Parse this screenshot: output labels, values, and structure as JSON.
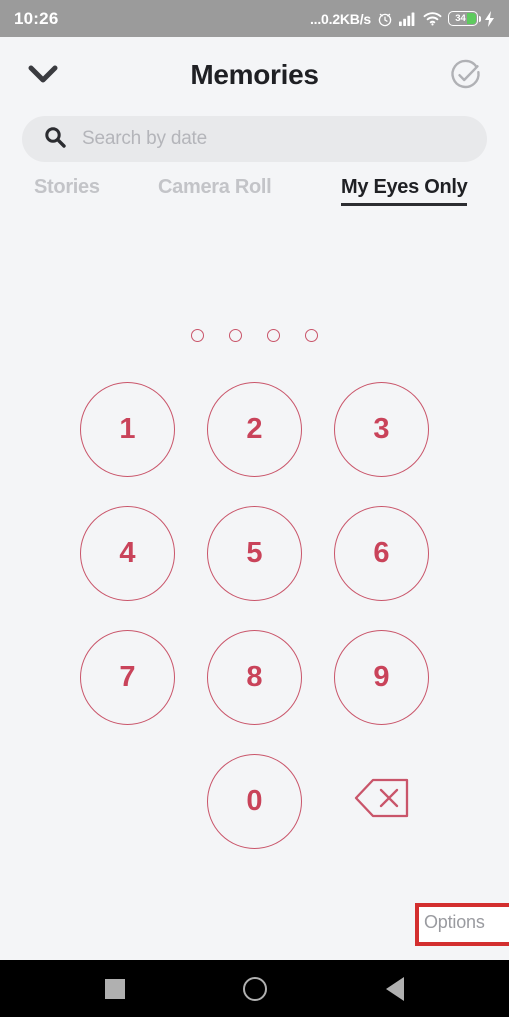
{
  "status_bar": {
    "time": "10:26",
    "network_speed": "...0.2KB/s",
    "alarm_icon": "alarm-clock-icon",
    "signal_icon": "cellular-signal-icon",
    "wifi_icon": "wifi-icon",
    "battery_level": "34",
    "charging_icon": "lightning-bolt-icon",
    "battery_fill_color": "#5ecb5e",
    "background_color": "#9b9b9b"
  },
  "header": {
    "back_icon": "chevron-down-icon",
    "title": "Memories",
    "select_icon": "check-circle-icon"
  },
  "search": {
    "icon": "search-icon",
    "placeholder": "Search by date",
    "value": ""
  },
  "tabs": [
    {
      "label": "Stories",
      "active": false
    },
    {
      "label": "Camera Roll",
      "active": false
    },
    {
      "label": "My Eyes Only",
      "active": true
    }
  ],
  "passcode": {
    "dot_count": 4,
    "filled_count": 0,
    "accent_color": "#c9556a"
  },
  "keypad": {
    "keys": [
      [
        "1",
        "2",
        "3"
      ],
      [
        "4",
        "5",
        "6"
      ],
      [
        "7",
        "8",
        "9"
      ],
      [
        "",
        "0",
        "backspace-icon"
      ]
    ],
    "digit_color": "#c9435a",
    "border_color": "#c9556a"
  },
  "options": {
    "label": "Options",
    "highlight_color": "#d32f2f"
  },
  "nav_bar": {
    "recents_icon": "square-recents-icon",
    "home_icon": "circle-home-icon",
    "back_icon": "triangle-back-icon",
    "background_color": "#000000"
  }
}
